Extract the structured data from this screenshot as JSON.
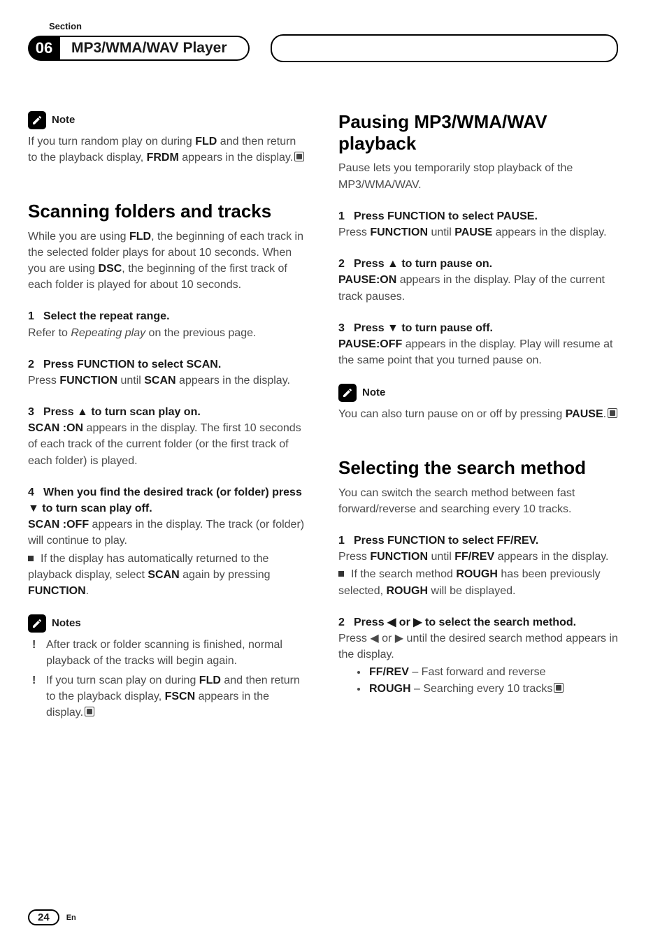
{
  "header": {
    "section_label": "Section",
    "chapter_number": "06",
    "chapter_title": "MP3/WMA/WAV Player"
  },
  "left": {
    "note1_label": "Note",
    "note1_p1a": "If you turn random play on during ",
    "note1_p1b": "FLD",
    "note1_p1c": " and then return to the playback display, ",
    "note1_p1d": "FRDM",
    "note1_p1e": " appears in the display.",
    "h2_scan": "Scanning folders and tracks",
    "scan_intro_a": "While you are using ",
    "scan_intro_b": "FLD",
    "scan_intro_c": ", the beginning of each track in the selected folder plays for about 10 seconds. When you are using ",
    "scan_intro_d": "DSC",
    "scan_intro_e": ", the beginning of the first track of each folder is played for about 10 seconds.",
    "step1_num": "1",
    "step1_head": "Select the repeat range.",
    "step1_body_a": "Refer to ",
    "step1_body_b": "Repeating play",
    "step1_body_c": " on the previous page.",
    "step2_num": "2",
    "step2_head": "Press FUNCTION to select SCAN.",
    "step2_body_a": "Press ",
    "step2_body_b": "FUNCTION",
    "step2_body_c": " until ",
    "step2_body_d": "SCAN",
    "step2_body_e": " appears in the display.",
    "step3_num": "3",
    "step3_head_a": "Press ",
    "step3_head_b": " to turn scan play on.",
    "step3_body_a": "SCAN :ON",
    "step3_body_b": " appears in the display. The first 10 seconds of each track of the current folder (or the first track of each folder) is played.",
    "step4_num": "4",
    "step4_head_a": "When you find the desired track (or folder) press ",
    "step4_head_b": " to turn scan play off.",
    "step4_body_a": "SCAN :OFF",
    "step4_body_b": " appears in the display. The track (or folder) will continue to play.",
    "step4_sq_a": "If the display has automatically returned to the playback display, select ",
    "step4_sq_b": "SCAN",
    "step4_sq_c": " again by pressing ",
    "step4_sq_d": "FUNCTION",
    "step4_sq_e": ".",
    "notes_label": "Notes",
    "notes_li1": "After track or folder scanning is finished, normal playback of the tracks will begin again.",
    "notes_li2_a": "If you turn scan play on during ",
    "notes_li2_b": "FLD",
    "notes_li2_c": " and then return to the playback display, ",
    "notes_li2_d": "FSCN",
    "notes_li2_e": " appears in the display."
  },
  "right": {
    "h2_pause": "Pausing MP3/WMA/WAV playback",
    "pause_intro": "Pause lets you temporarily stop playback of the MP3/WMA/WAV.",
    "p1_num": "1",
    "p1_head": "Press FUNCTION to select PAUSE.",
    "p1_body_a": "Press ",
    "p1_body_b": "FUNCTION",
    "p1_body_c": " until ",
    "p1_body_d": "PAUSE",
    "p1_body_e": " appears in the display.",
    "p2_num": "2",
    "p2_head_a": "Press ",
    "p2_head_b": " to turn pause on.",
    "p2_body_a": "PAUSE:ON",
    "p2_body_b": " appears in the display. Play of the current track pauses.",
    "p3_num": "3",
    "p3_head_a": "Press ",
    "p3_head_b": " to turn pause off.",
    "p3_body_a": "PAUSE:OFF",
    "p3_body_b": " appears in the display. Play will resume at the same point that you turned pause on.",
    "note2_label": "Note",
    "note2_a": "You can also turn pause on or off by pressing ",
    "note2_b": "PAUSE",
    "note2_c": ".",
    "h2_search": "Selecting the search method",
    "search_intro": "You can switch the search method between fast forward/reverse and searching every 10 tracks.",
    "s1_num": "1",
    "s1_head": "Press FUNCTION to select FF/REV.",
    "s1_body_a": "Press ",
    "s1_body_b": "FUNCTION",
    "s1_body_c": " until ",
    "s1_body_d": "FF/REV",
    "s1_body_e": " appears in the display.",
    "s1_sq_a": "If the search method ",
    "s1_sq_b": "ROUGH",
    "s1_sq_c": " has been previously selected, ",
    "s1_sq_d": "ROUGH",
    "s1_sq_e": " will be displayed.",
    "s2_num": "2",
    "s2_head_a": "Press ",
    "s2_head_b": " or ",
    "s2_head_c": " to select the search method.",
    "s2_body_a": "Press ",
    "s2_body_b": " or ",
    "s2_body_c": " until the desired search method appears in the display.",
    "s2_li1_a": "FF/REV",
    "s2_li1_b": " – Fast forward and reverse",
    "s2_li2_a": "ROUGH",
    "s2_li2_b": " – Searching every 10 tracks"
  },
  "footer": {
    "page": "24",
    "lang": "En"
  }
}
